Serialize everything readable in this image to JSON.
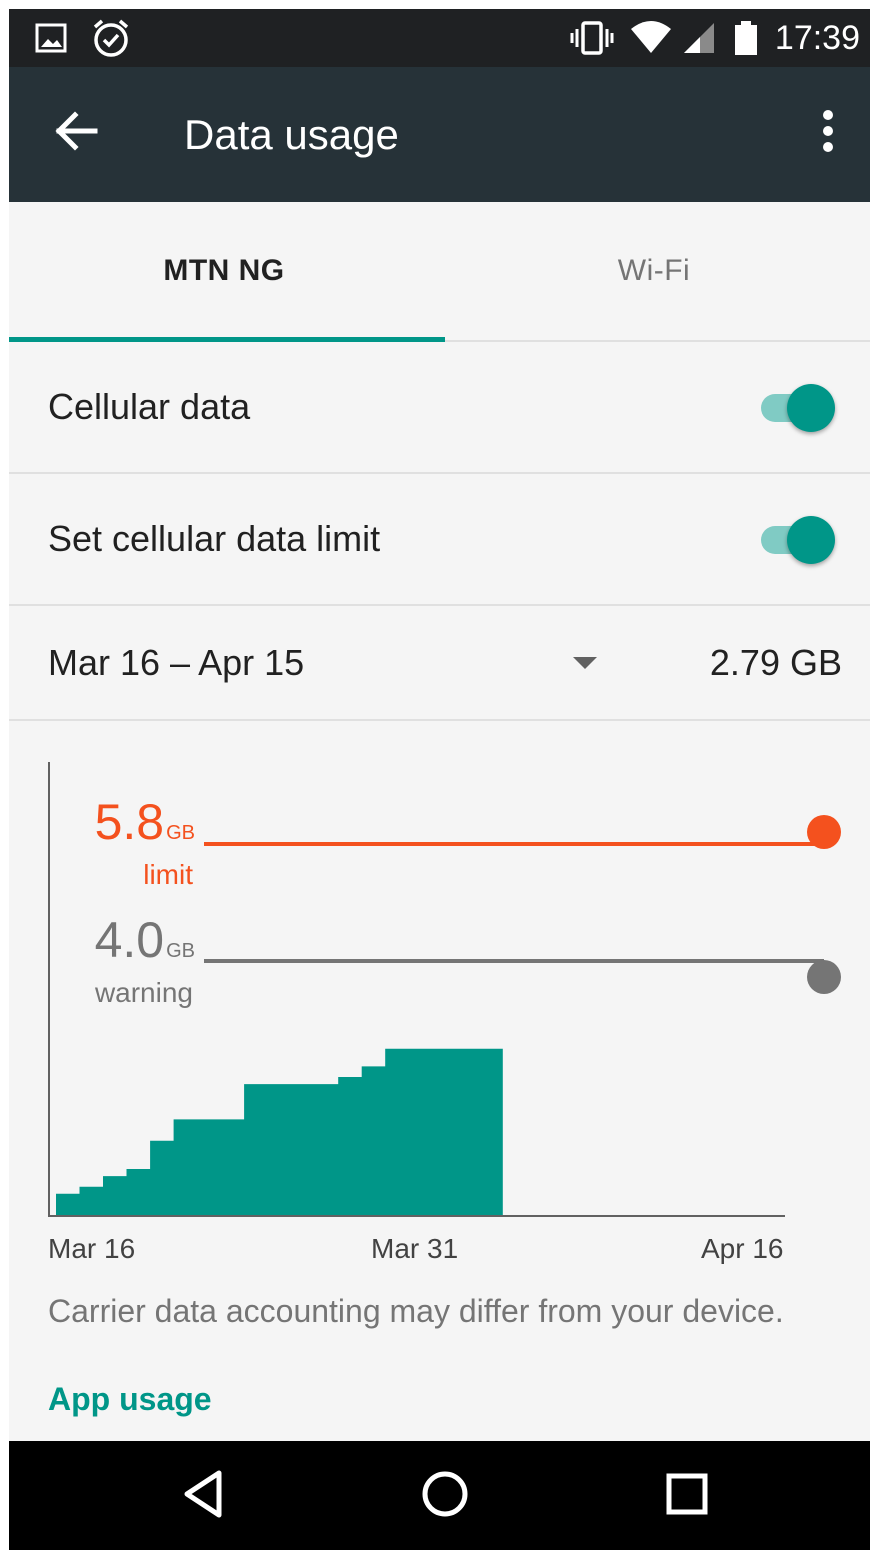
{
  "status_bar": {
    "time": "17:39",
    "icons": [
      "image-notification-icon",
      "alarm-icon",
      "vibrate-icon",
      "wifi-icon",
      "cell-signal-icon",
      "battery-icon"
    ]
  },
  "app_bar": {
    "title": "Data usage",
    "back_icon": "arrow-back-icon",
    "more_icon": "more-vert-icon"
  },
  "tabs": [
    {
      "label": "MTN NG",
      "selected": true
    },
    {
      "label": "Wi-Fi",
      "selected": false
    }
  ],
  "settings": {
    "cellular_data": {
      "label": "Cellular data",
      "enabled": true
    },
    "data_limit": {
      "label": "Set cellular data limit",
      "enabled": true
    }
  },
  "cycle": {
    "range": "Mar 16 – Apr 15",
    "total": "2.79 GB"
  },
  "chart_data": {
    "type": "area",
    "limit": {
      "value": "5.8",
      "unit": "GB",
      "label": "limit",
      "color": "#f4511e"
    },
    "warning": {
      "value": "4.0",
      "unit": "GB",
      "label": "warning",
      "color": "#757575"
    },
    "x_tick_labels": [
      "Mar 16",
      "Mar 31",
      "Apr 16"
    ],
    "series": [
      {
        "color": "#009688",
        "days": [
          "Mar 16",
          "Mar 17",
          "Mar 18",
          "Mar 19",
          "Mar 20",
          "Mar 21",
          "Mar 22",
          "Mar 23",
          "Mar 24",
          "Mar 25",
          "Mar 26",
          "Mar 27",
          "Mar 28",
          "Mar 29",
          "Mar 30",
          "Mar 31",
          "Apr 1",
          "Apr 2",
          "Apr 3"
        ],
        "cumulative_gb": [
          0.3,
          0.4,
          0.55,
          0.65,
          1.05,
          1.35,
          1.35,
          1.35,
          1.85,
          1.85,
          1.85,
          1.85,
          1.95,
          2.1,
          2.35,
          2.35,
          2.35,
          2.35,
          2.35
        ]
      }
    ],
    "y_max_gb": 6.4
  },
  "footer": {
    "carrier_note": "Carrier data accounting may differ from your device.",
    "app_usage_link": "App usage"
  },
  "nav_bar": {
    "icons": [
      "back-triangle-icon",
      "home-circle-icon",
      "recents-square-icon"
    ]
  },
  "colors": {
    "accent": "#009688",
    "app_bar": "#263238",
    "status_bar": "#1f2123",
    "limit": "#f4511e"
  }
}
